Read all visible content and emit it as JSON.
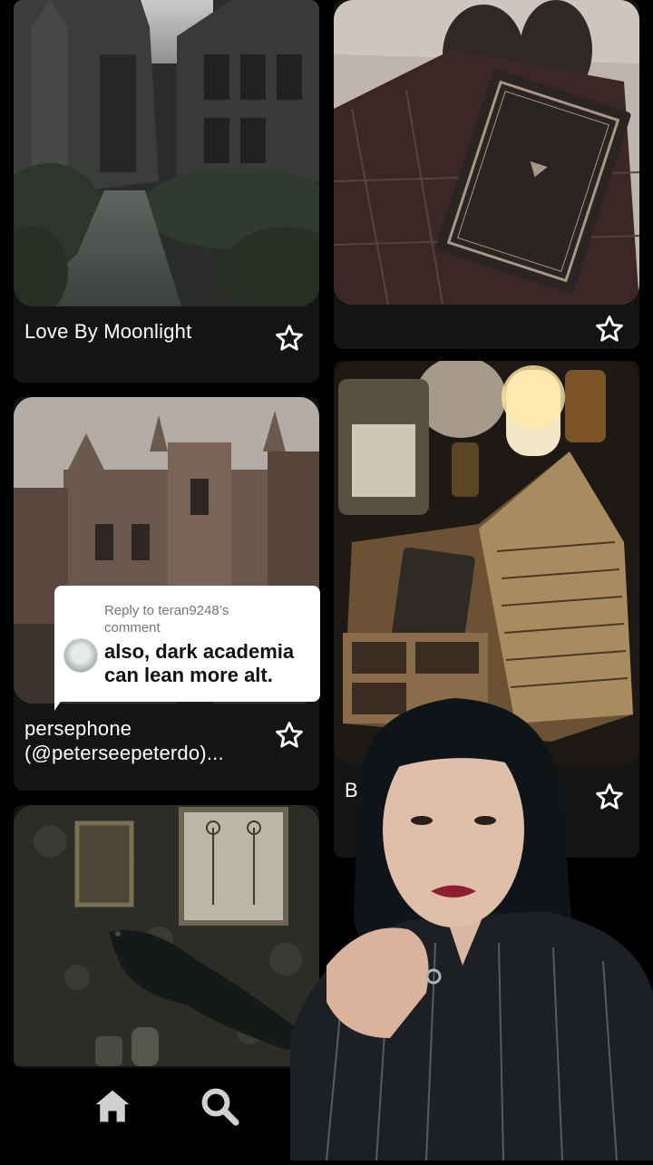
{
  "cards": [
    {
      "title": "Love By Moonlight",
      "image": "gothic-garden-path-photo"
    },
    {
      "title": "",
      "image": "book-on-plaid-skirt-photo"
    },
    {
      "title": "persephone\n(@peterseepeterdo)...",
      "image": "gothic-college-building-photo"
    },
    {
      "title": "B",
      "title_line2": "(",
      "image": "poison-bottles-and-old-book-photo"
    },
    {
      "title": "",
      "image": "raven-and-anatomy-frames-photo"
    }
  ],
  "comment_reply": {
    "header": "Reply to teran9248’s\ncomment",
    "text": "also, dark academia\ncan lean more alt."
  },
  "nav": {
    "home_icon": "home-icon",
    "search_icon": "search-icon"
  },
  "colors": {
    "background": "#000000",
    "card": "#141414",
    "text": "#ffffff"
  }
}
